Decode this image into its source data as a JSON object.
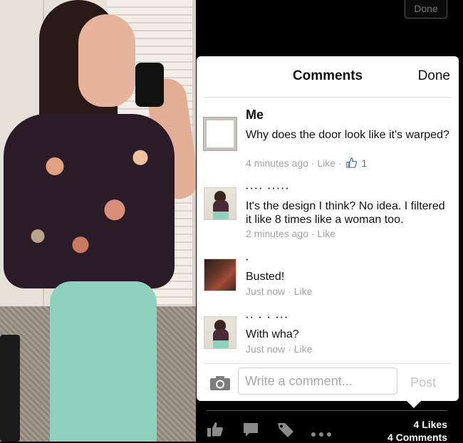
{
  "top_bar": {
    "done_label": "Done"
  },
  "comments_sheet": {
    "title": "Comments",
    "done_label": "Done",
    "comments": [
      {
        "author": "Me",
        "text": "Why does the door look like it's warped?",
        "time": "4 minutes ago",
        "like_label": "Like",
        "like_count": "1"
      },
      {
        "author": "···· ·····",
        "text": "It's the design I think? No idea. I filtered it like 8 times like a woman too.",
        "time": "2 minutes ago",
        "like_label": "Like"
      },
      {
        "author": "·",
        "text": "Busted!",
        "time": "Just now",
        "like_label": "Like"
      },
      {
        "author": "·· · · ···",
        "text": "With wha?",
        "time": "Just now",
        "like_label": "Like"
      }
    ],
    "compose": {
      "placeholder": "Write a comment...",
      "post_label": "Post"
    }
  },
  "bottom_bar": {
    "likes": "4 Likes",
    "comments": "4 Comments"
  },
  "icons": [
    "camera-icon",
    "like-thumb-icon",
    "comment-bubble-icon",
    "tag-icon",
    "more-dots-icon"
  ],
  "colors": {
    "meta_text": "#a3a3a3",
    "post_disabled": "#c5c5c5",
    "sheet_bg": "#ffffff",
    "app_bg": "#000000"
  }
}
